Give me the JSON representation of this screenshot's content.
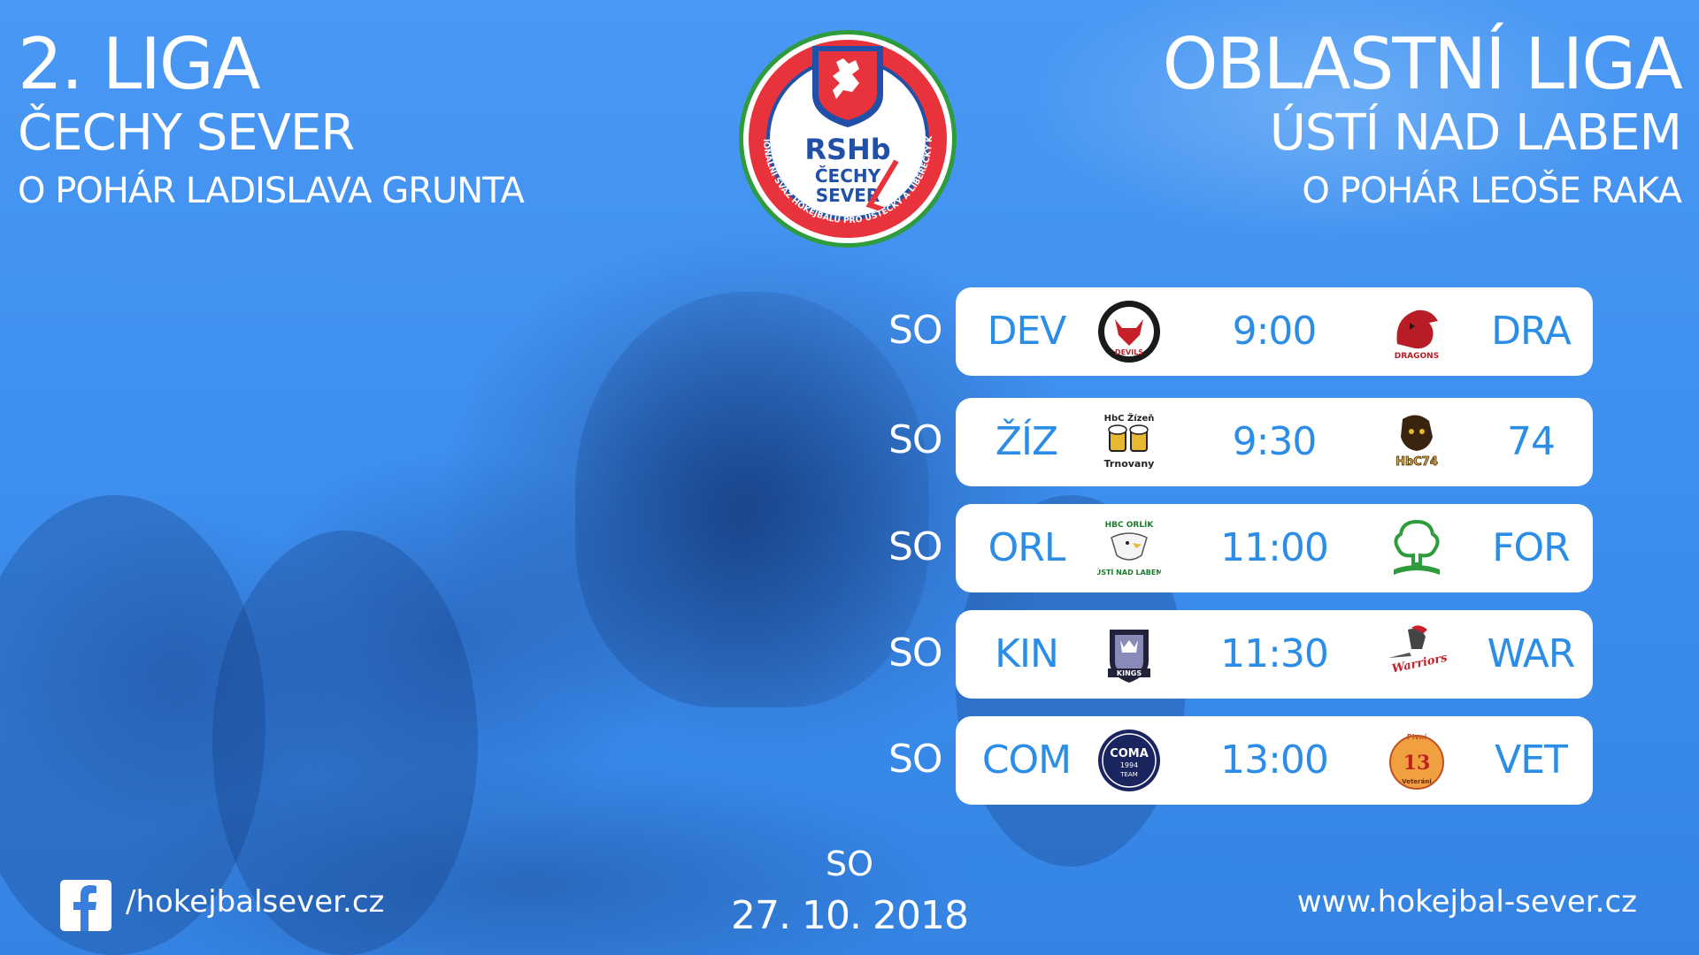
{
  "left_title": {
    "line1": "2. LIGA",
    "line2": "ČECHY SEVER",
    "line3": "O POHÁR LADISLAVA GRUNTA"
  },
  "right_title": {
    "line1": "OBLASTNÍ LIGA",
    "line2": "ÚSTÍ NAD LABEM",
    "line3": "O POHÁR LEOŠE RAKA"
  },
  "logo": {
    "abbr": "RSHb",
    "line1": "ČECHY",
    "line2": "SEVER",
    "ring_text": "REGIONÁLNÍ SVAZ HOKEJBALU PRO ÚSTECKÝ A LIBERECKÝ KRAJ",
    "colors": {
      "red": "#e8323c",
      "blue": "#2050a8",
      "green": "#2e9b3c"
    }
  },
  "matches": [
    {
      "day": "SO",
      "home": "DEV",
      "time": "9:00",
      "away": "DRA",
      "home_icon": "devils-decin-badge-icon",
      "away_icon": "dragons-usti-badge-icon"
    },
    {
      "day": "SO",
      "home": "ŽÍZ",
      "time": "9:30",
      "away": "74",
      "home_icon": "hbc-zizen-trnovany-badge-icon",
      "away_icon": "hbc-74-badge-icon"
    },
    {
      "day": "SO",
      "home": "ORL",
      "time": "11:00",
      "away": "FOR",
      "home_icon": "hbc-orlik-badge-icon",
      "away_icon": "forest-tree-badge-icon"
    },
    {
      "day": "SO",
      "home": "KIN",
      "time": "11:30",
      "away": "WAR",
      "home_icon": "kings-badge-icon",
      "away_icon": "warriors-badge-icon"
    },
    {
      "day": "SO",
      "home": "COM",
      "time": "13:00",
      "away": "VET",
      "home_icon": "coma-team-badge-icon",
      "away_icon": "pivni-veterani-badge-icon"
    }
  ],
  "badge_text": {
    "zizen_top": "HbC Žízeň",
    "zizen_bottom": "Trnovany",
    "orlik_top": "HBC ORLÍK",
    "orlik_bottom": "ÚSTÍ NAD LABEM",
    "kings": "KINGS",
    "coma": "COMA",
    "coma_year": "1994",
    "coma_team": "TEAM",
    "hbc74": "HbC74",
    "dragons": "DRAGONS",
    "warriors": "Warriors",
    "veterani_top": "Pivní",
    "veterani_bottom": "Veteráni",
    "devils": "DEVILS"
  },
  "footer": {
    "day": "SO",
    "date": "27. 10. 2018",
    "facebook": "/hokejbalsever.cz",
    "website": "www.hokejbal-sever.cz"
  },
  "colors": {
    "accent": "#2c8de6",
    "background": "#3f8ef0",
    "card": "#ffffff"
  }
}
